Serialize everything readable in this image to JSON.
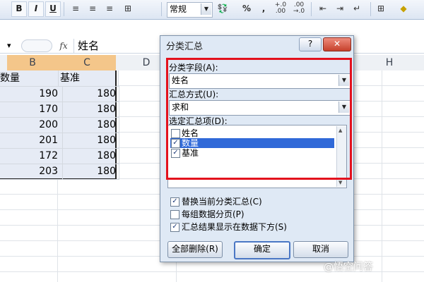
{
  "toolbar": {
    "bold": "B",
    "italic": "I",
    "underline": "U",
    "number_format": "常规",
    "percent": "%",
    "comma": ",",
    "inc_decimal": "+.0\n.00",
    "dec_decimal": ".00\n→.0"
  },
  "formula_bar": {
    "namebox": "▾",
    "fx": "fx",
    "value": "姓名"
  },
  "columns": [
    {
      "letter": "B",
      "selected": true
    },
    {
      "letter": "C",
      "selected": true
    },
    {
      "letter": "D",
      "selected": false
    },
    {
      "letter": "H",
      "selected": false
    }
  ],
  "sheet": {
    "headers": [
      "数量",
      "基准"
    ],
    "rows": [
      [
        "190",
        "180"
      ],
      [
        "170",
        "180"
      ],
      [
        "200",
        "180"
      ],
      [
        "201",
        "180"
      ],
      [
        "172",
        "180"
      ],
      [
        "203",
        "180"
      ]
    ]
  },
  "dialog": {
    "title": "分类汇总",
    "help": "?",
    "close": "✕",
    "group_field_label": "分类字段(A):",
    "group_field_value": "姓名",
    "function_label": "汇总方式(U):",
    "function_value": "求和",
    "items_label": "选定汇总项(D):",
    "items": [
      {
        "label": "姓名",
        "checked": false,
        "selected": false
      },
      {
        "label": "数量",
        "checked": true,
        "selected": true
      },
      {
        "label": "基准",
        "checked": true,
        "selected": false
      }
    ],
    "options": [
      {
        "label": "替换当前分类汇总(C)",
        "checked": true
      },
      {
        "label": "每组数据分页(P)",
        "checked": false
      },
      {
        "label": "汇总结果显示在数据下方(S)",
        "checked": true
      }
    ],
    "buttons": {
      "remove_all": "全部删除(R)",
      "ok": "确定",
      "cancel": "取消"
    }
  },
  "highlight_color": "#e3111d",
  "selection_color": "#3069d8",
  "watermark": "@悟空问答"
}
